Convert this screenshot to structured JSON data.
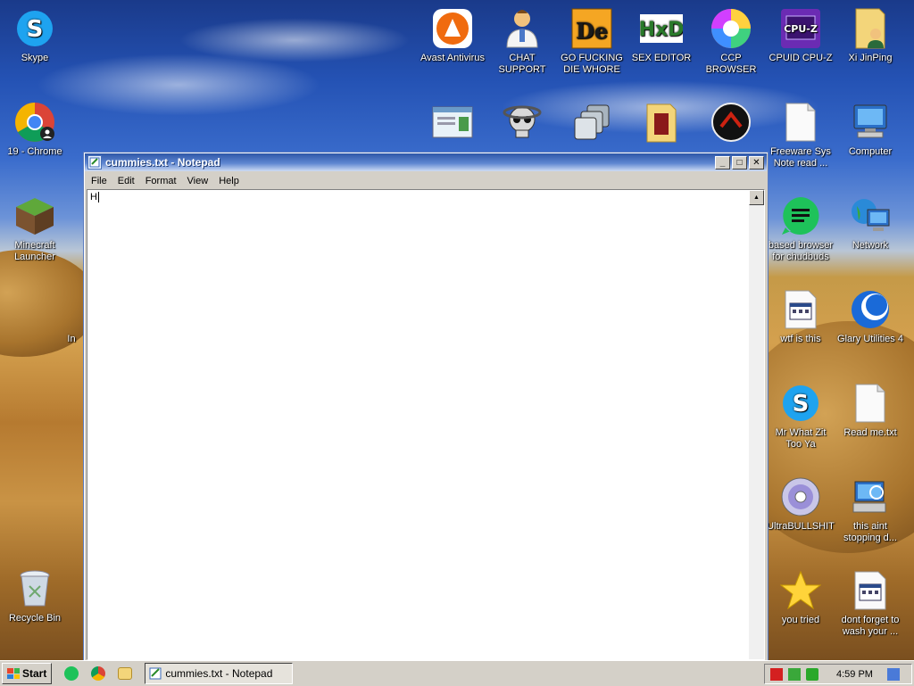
{
  "desktop": {
    "icons_left": [
      {
        "label": "Skype",
        "icon": "skype-icon"
      },
      {
        "label": "19 - Chrome",
        "icon": "chrome-icon"
      },
      {
        "label": "Minecraft Launcher",
        "icon": "minecraft-icon"
      },
      {
        "label": "In",
        "icon": "partial-icon"
      },
      {
        "label": "Recycle Bin",
        "icon": "recycle-bin-icon"
      }
    ],
    "icons_top": [
      {
        "label": "Avast Antivirus",
        "icon": "avast-icon"
      },
      {
        "label": "CHAT SUPPORT",
        "icon": "doctor-icon"
      },
      {
        "label": "GO FUCKING DIE WHORE",
        "icon": "de-icon"
      },
      {
        "label": "SEX EDITOR",
        "icon": "hxd-icon"
      },
      {
        "label": "CCP BROWSER",
        "icon": "ccp-browser-icon"
      },
      {
        "label": "CPUID CPU-Z",
        "icon": "cpuz-icon"
      },
      {
        "label": "Xi JinPing",
        "icon": "folder-user-icon"
      }
    ],
    "icons_right": [
      {
        "label": "Freeware Sys Note read ...",
        "icon": "text-file-icon"
      },
      {
        "label": "Computer",
        "icon": "computer-icon"
      },
      {
        "label": "based browser for chudbuds",
        "icon": "green-browser-icon"
      },
      {
        "label": "Network",
        "icon": "network-icon"
      },
      {
        "label": "wtf is this",
        "icon": "app-file-icon"
      },
      {
        "label": "Glary Utilities 4",
        "icon": "glary-icon"
      },
      {
        "label": "Mr What Zit Too Ya",
        "icon": "skype-icon"
      },
      {
        "label": "Read me.txt",
        "icon": "text-file-icon"
      },
      {
        "label": "UltraBULLSHIT",
        "icon": "disc-icon"
      },
      {
        "label": "this aint stopping d...",
        "icon": "pc-search-icon"
      },
      {
        "label": "you tried",
        "icon": "star-icon"
      },
      {
        "label": "dont forget to wash your ...",
        "icon": "app-file-icon"
      }
    ]
  },
  "notepad": {
    "title": "cummies.txt - Notepad",
    "menu": [
      "File",
      "Edit",
      "Format",
      "View",
      "Help"
    ],
    "content": "H"
  },
  "taskbar": {
    "start_label": "Start",
    "task_label": "cummies.txt - Notepad",
    "clock": "4:59 PM"
  }
}
